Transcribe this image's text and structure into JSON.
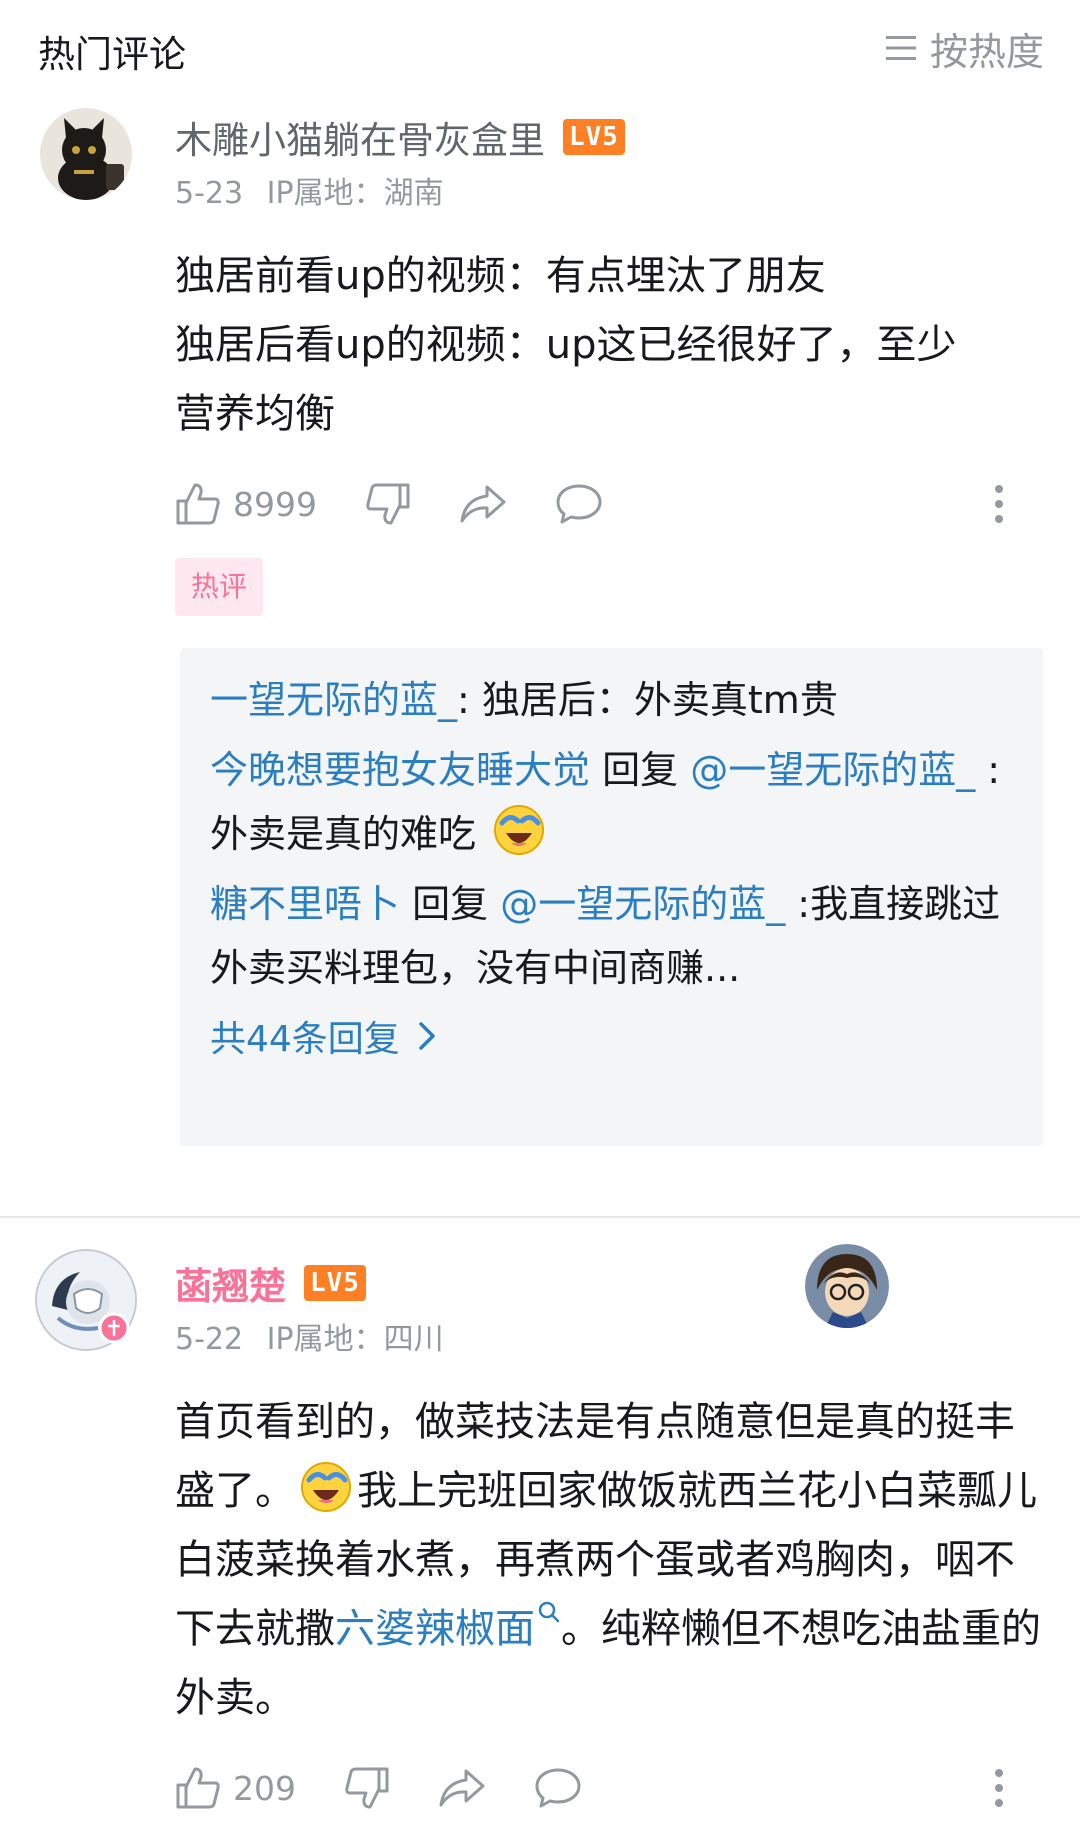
{
  "header": {
    "title": "热门评论",
    "sort_label": "按热度",
    "sort_icon": "menu-lines-icon"
  },
  "comments": [
    {
      "username": "木雕小猫躺在骨灰盒里",
      "level": "LV5",
      "date": "5-23",
      "location": "IP属地：湖南",
      "content_lines": [
        "独居前看up的视频：有点埋汰了朋友",
        "独居后看up的视频：up这已经很好了，至少",
        "营养均衡"
      ],
      "like_count": "8999",
      "tag": "热评",
      "replies": [
        {
          "user": "一望无际的蓝_",
          "sep": ": ",
          "text": "独居后：外卖真tm贵"
        },
        {
          "user": "今晚想要抱女友睡大觉",
          "reply_word": " 回复 ",
          "mention": "@一望无际的蓝_",
          "text": " :外卖是真的难吃"
        },
        {
          "user": "糖不里唔卜",
          "reply_word": " 回复 ",
          "mention": "@一望无际的蓝_",
          "text": " :我直接跳过外卖买料理包，没有中间商赚..."
        }
      ],
      "reply_more": "共44条回复"
    },
    {
      "username": "菡翘楚",
      "level": "LV5",
      "date": "5-22",
      "location": "IP属地：四川",
      "content_a": "首页看到的，做菜技法是有点随意但是真的挺丰盛了。",
      "content_b": "我上完班回家做饭就西兰花小白菜瓢儿白菠菜换着水煮，再煮两个蛋或者鸡胸肉，咽不下去就撒",
      "content_link": "六婆辣椒面",
      "content_c": "。纯粹懒但不想吃油盐重的外卖。",
      "like_count": "209"
    }
  ],
  "colors": {
    "link_blue": "#2b7fc0",
    "pink": "#fb7299",
    "level_orange": "#ff7f24",
    "gray_text": "#9499a0",
    "reply_bg": "#f4f5f7"
  }
}
